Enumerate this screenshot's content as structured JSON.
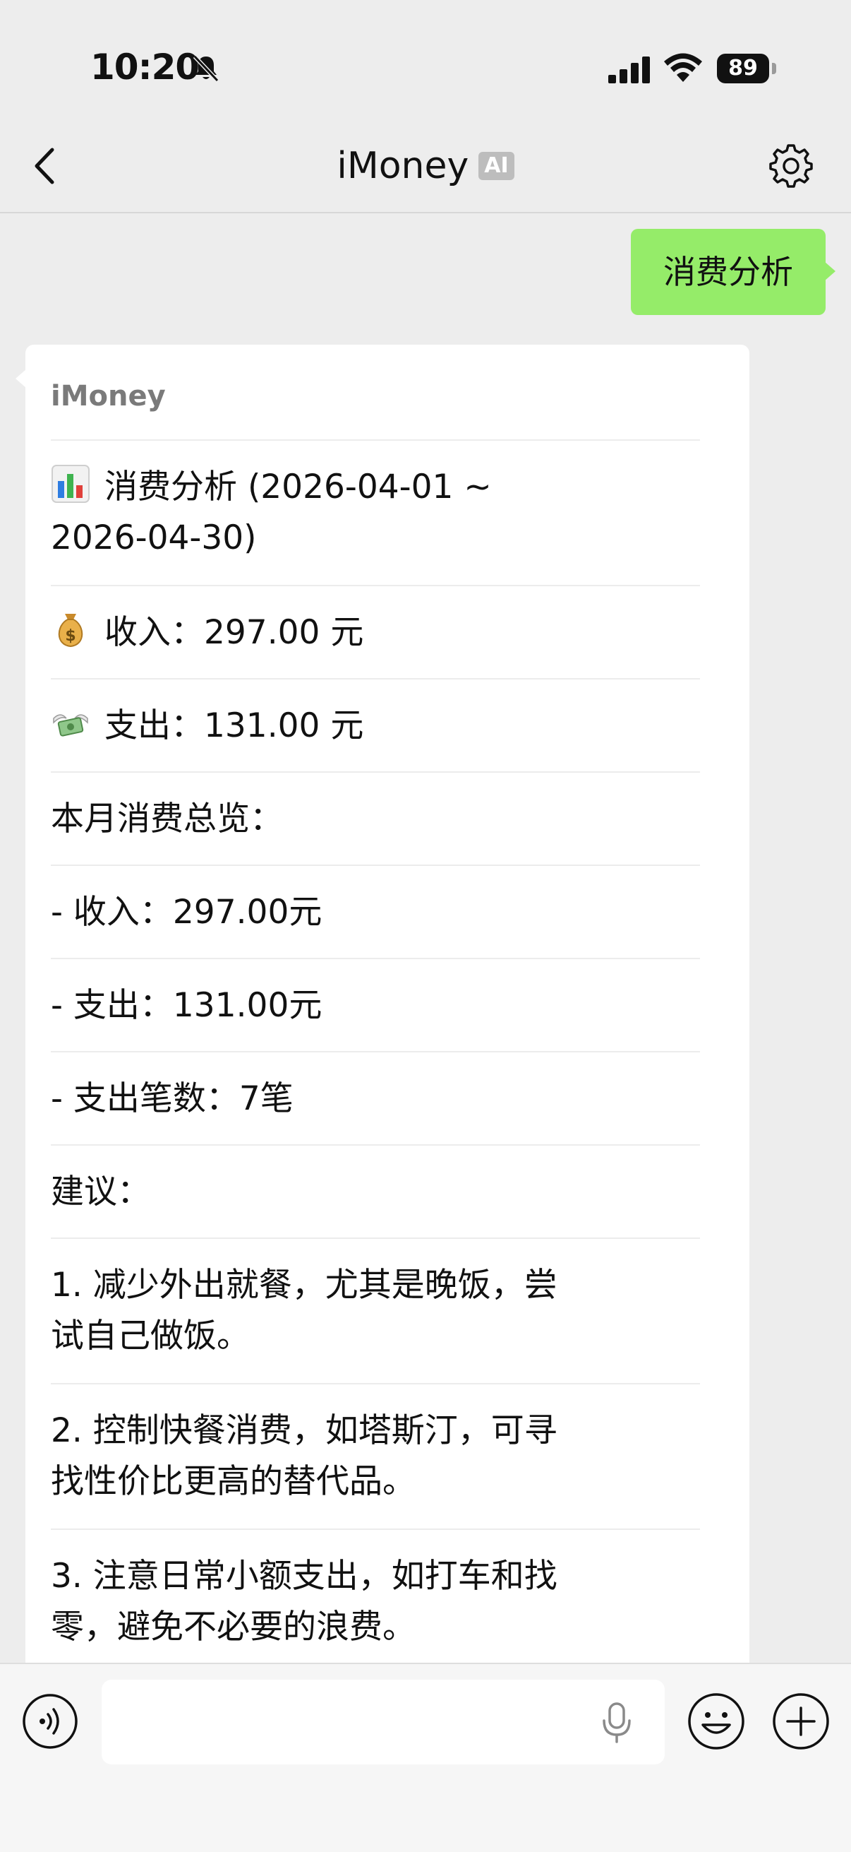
{
  "status_bar": {
    "time": "10:20",
    "battery_level": "89"
  },
  "nav": {
    "title": "iMoney",
    "badge": "AI"
  },
  "chat": {
    "user_message": "消费分析",
    "bot": {
      "sender": "iMoney",
      "summary_title_line1": "消费分析 (2026-04-01 ~",
      "summary_title_line2": "2026-04-30)",
      "income": "收入：297.00 元",
      "expense": "支出：131.00 元",
      "overview_heading": "本月消费总览：",
      "overview_income": "- 收入：297.00元",
      "overview_expense": "- 支出：131.00元",
      "overview_count": "- 支出笔数：7笔",
      "advice_heading": "建议：",
      "advice_1_line1": "1. 减少外出就餐，尤其是晚饭，尝",
      "advice_1_line2": "试自己做饭。",
      "advice_2_line1": "2. 控制快餐消费，如塔斯汀，可寻",
      "advice_2_line2": "找性价比更高的替代品。",
      "advice_3_line1": "3. 注意日常小额支出，如打车和找",
      "advice_3_line2": "零，避免不必要的浪费。"
    }
  },
  "input": {
    "placeholder": ""
  },
  "colors": {
    "user_bubble": "#95ec69",
    "background": "#ededed",
    "card": "#ffffff"
  },
  "icons": {
    "chart": "bar-chart-icon",
    "income": "money-bag-icon",
    "expense": "money-with-wings-icon"
  }
}
